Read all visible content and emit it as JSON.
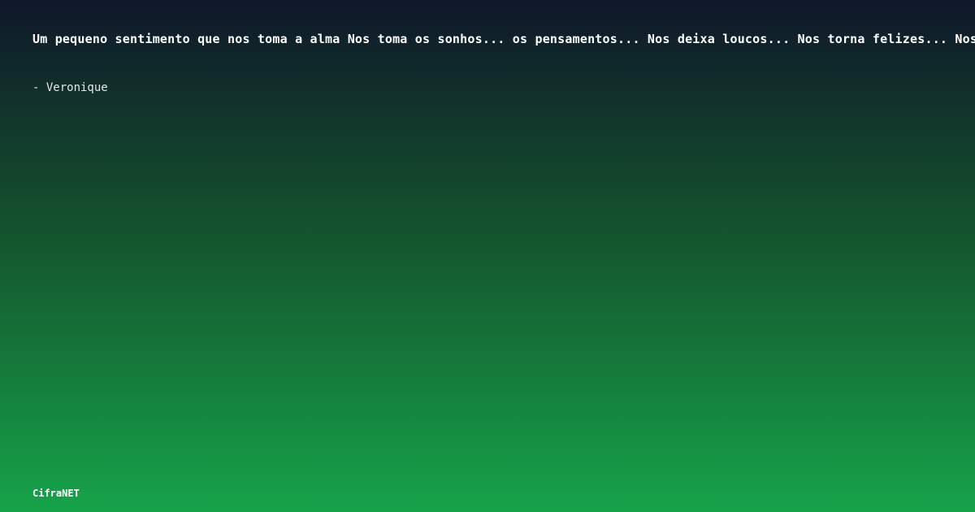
{
  "card": {
    "quote": "Um pequeno sentimento que nos toma a alma Nos toma os sonhos... os pensamentos... Nos deixa loucos... Nos torna felizes... Nos fa",
    "author": "- Veronique",
    "brand": "CifraNET"
  },
  "colors": {
    "gradient_top": "#0f172a",
    "gradient_mid": "#14532d",
    "gradient_bottom": "#16a34a",
    "text": "#ffffff"
  }
}
